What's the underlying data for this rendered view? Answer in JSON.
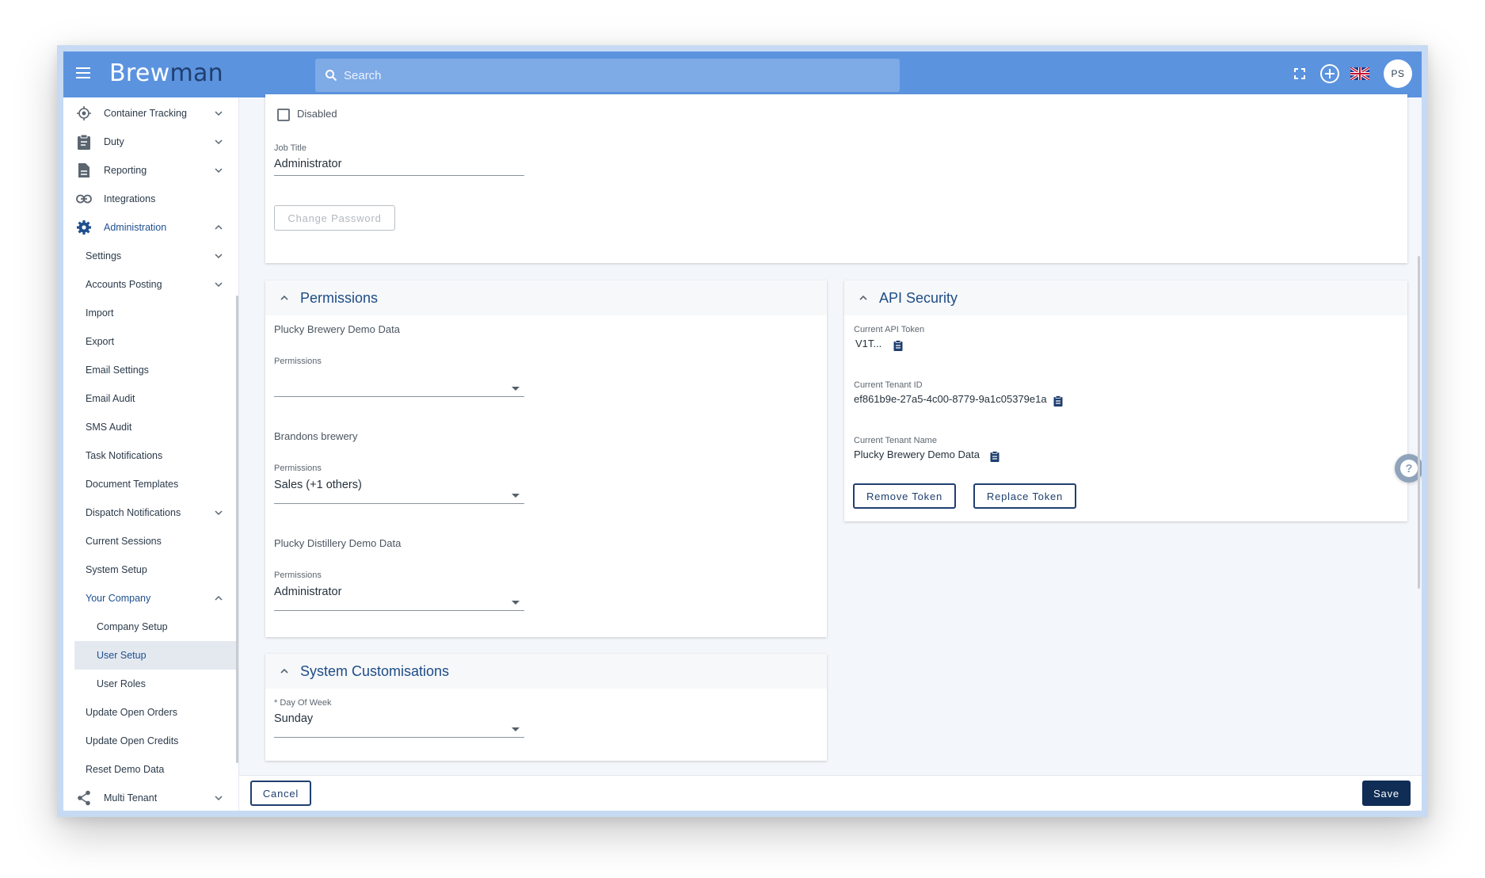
{
  "app": {
    "logo_main": "Brew",
    "logo_accent": "man",
    "search_placeholder": "Search",
    "avatar_initials": "PS"
  },
  "sidebar": {
    "items": [
      {
        "label": "Container Tracking",
        "icon": "target-icon"
      },
      {
        "label": "Duty",
        "icon": "clipboard-icon"
      },
      {
        "label": "Reporting",
        "icon": "document-icon"
      },
      {
        "label": "Integrations",
        "icon": "link-icon"
      },
      {
        "label": "Administration",
        "icon": "gear-icon"
      }
    ],
    "admin_items": [
      "Settings",
      "Accounts Posting",
      "Import",
      "Export",
      "Email Settings",
      "Email Audit",
      "SMS Audit",
      "Task Notifications",
      "Document Templates",
      "Dispatch Notifications",
      "Current Sessions",
      "System Setup",
      "Your Company"
    ],
    "company_items": [
      "Company Setup",
      "User Setup",
      "User Roles"
    ],
    "after_items": [
      "Update Open Orders",
      "Update Open Credits",
      "Reset Demo Data"
    ],
    "multi_tenant": "Multi Tenant"
  },
  "user_card": {
    "disabled_label": "Disabled",
    "job_title_label": "Job Title",
    "job_title_value": "Administrator",
    "change_password": "Change Password"
  },
  "permissions": {
    "title": "Permissions",
    "tenants": [
      {
        "name": "Plucky Brewery Demo Data",
        "label": "Permissions",
        "value": ""
      },
      {
        "name": "Brandons brewery",
        "label": "Permissions",
        "value": "Sales (+1 others)"
      },
      {
        "name": "Plucky Distillery Demo Data",
        "label": "Permissions",
        "value": "Administrator"
      }
    ]
  },
  "api_security": {
    "title": "API Security",
    "token_label": "Current API Token",
    "token_value": "V1T...",
    "tenant_id_label": "Current Tenant ID",
    "tenant_id_value": "ef861b9e-27a5-4c00-8779-9a1c05379e1a",
    "tenant_name_label": "Current Tenant Name",
    "tenant_name_value": "Plucky Brewery Demo Data",
    "remove_token": "Remove Token",
    "replace_token": "Replace Token"
  },
  "customisations": {
    "title": "System Customisations",
    "day_label": "* Day Of Week",
    "day_value": "Sunday"
  },
  "footer": {
    "cancel": "Cancel",
    "save": "Save"
  },
  "colors": {
    "appbar": "#5b93df",
    "primary": "#0f2d55",
    "accent_text": "#1d4c86"
  }
}
